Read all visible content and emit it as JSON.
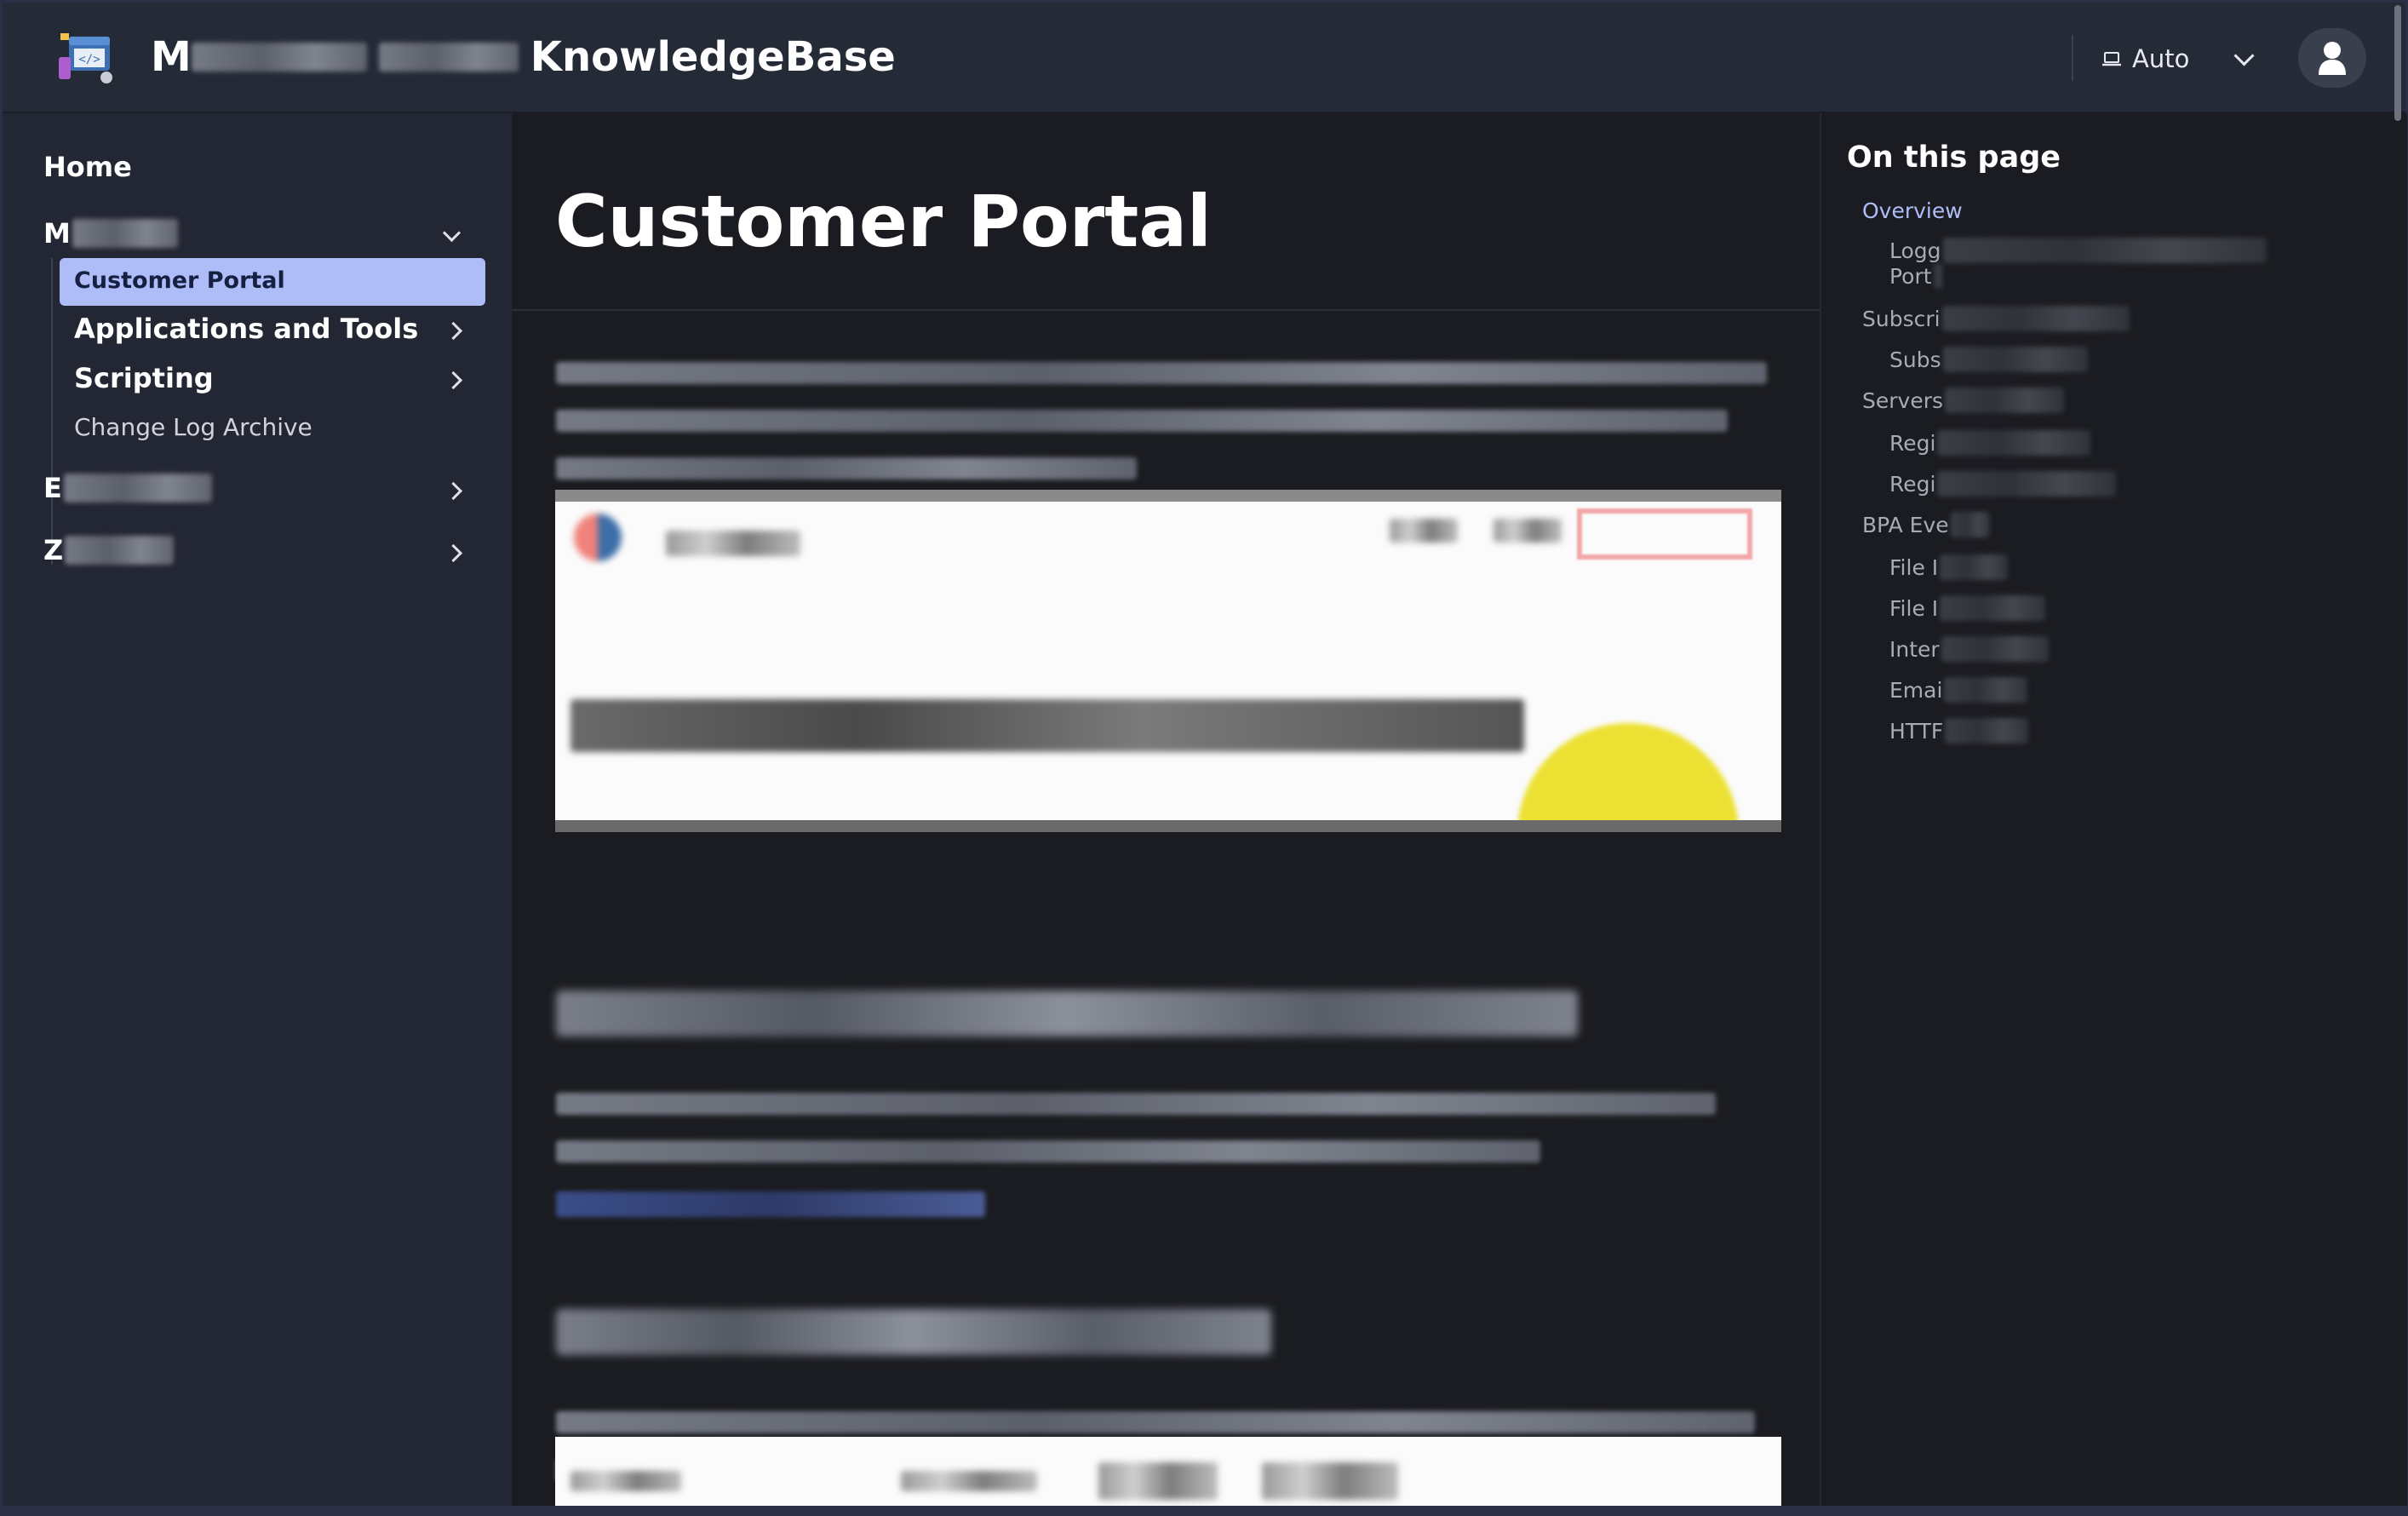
{
  "header": {
    "title_prefix": "M",
    "title_suffix": "KnowledgeBase",
    "theme_label": "Auto"
  },
  "sidebar": {
    "home": "Home",
    "group1_initial": "M",
    "active_item": "Customer Portal",
    "sub_items": [
      "Applications and Tools",
      "Scripting",
      "Change Log Archive"
    ],
    "group2_initial": "E",
    "group3_initial": "Z"
  },
  "main": {
    "title": "Customer Portal"
  },
  "toc": {
    "title": "On this page",
    "items": [
      "Overview",
      "Logg",
      "Port",
      "Subscri",
      "Subs",
      "Servers",
      "Regi",
      "Regi",
      "BPA Eve",
      "File I",
      "File I",
      "Inter",
      "Emai",
      "HTTF"
    ]
  },
  "icons": {
    "logo": "code-editor-logo-icon",
    "theme": "laptop-icon",
    "user": "user-icon"
  },
  "colors": {
    "accent": "#aebdf8",
    "header_bg": "#252a37",
    "sidebar_bg": "#232633",
    "main_bg": "#1b1c21"
  }
}
